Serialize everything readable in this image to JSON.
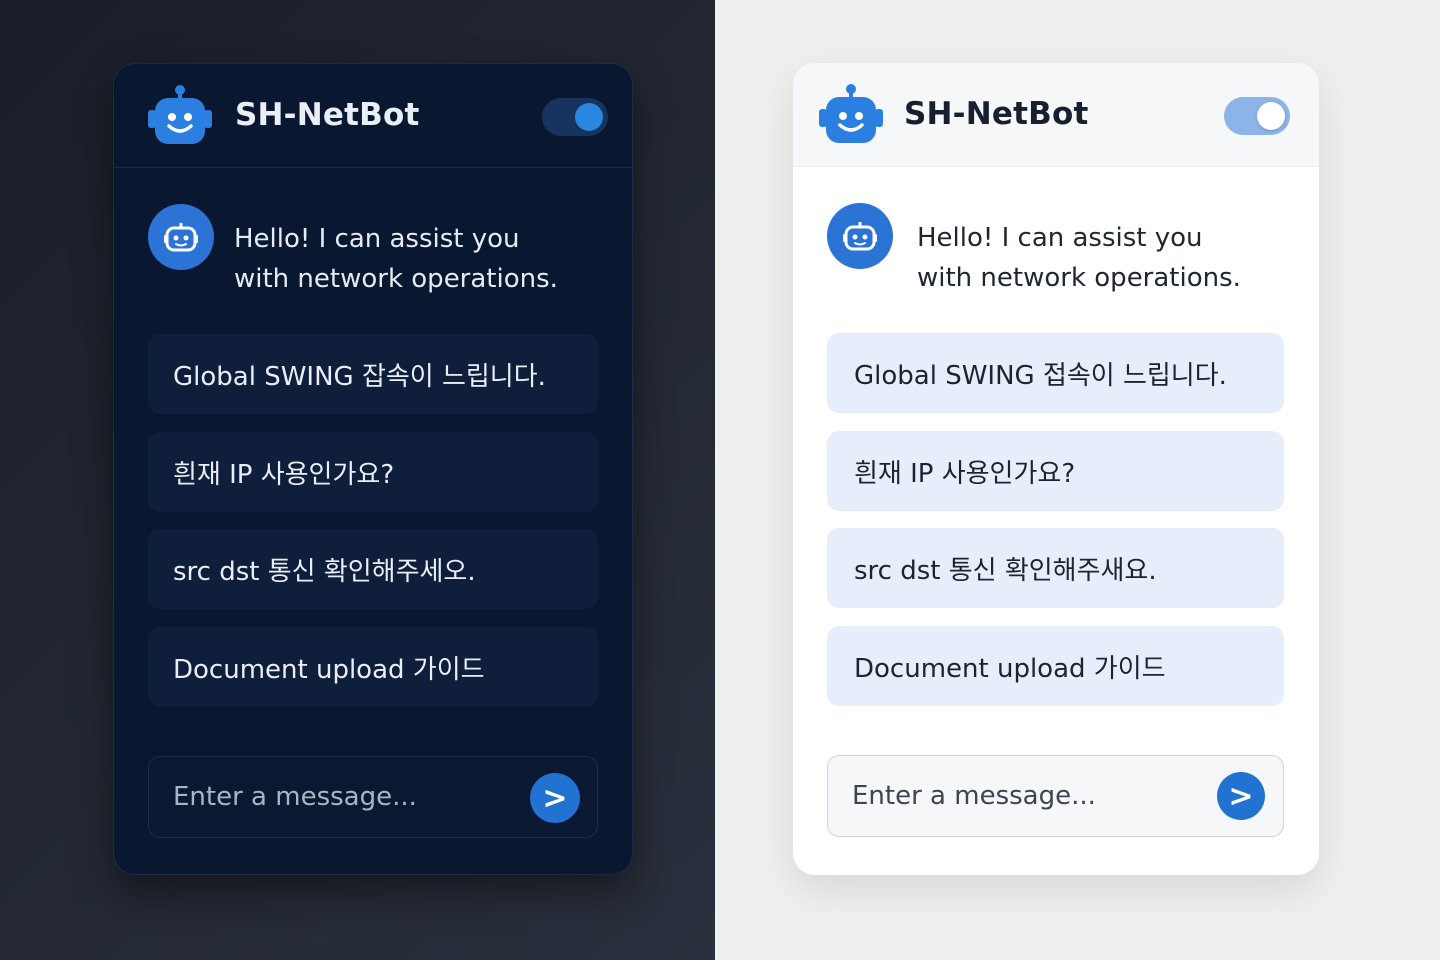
{
  "panels": [
    {
      "theme": "dark",
      "header": {
        "title": "SH-NetBot",
        "toggle_on": true
      },
      "greeting": {
        "line1": "Hello! I can assist you",
        "line2": "with network operations."
      },
      "suggestions": [
        "Global SWING 잡속이 느립니다.",
        "흰재 IP 사용인가요?",
        "src dst 통신 확인해주세오.",
        "Document upload 가이드"
      ],
      "input": {
        "placeholder": "Enter a message..."
      },
      "send_icon": ">"
    },
    {
      "theme": "light",
      "header": {
        "title": "SH-NetBot",
        "toggle_on": true
      },
      "greeting": {
        "line1": "Hello! I can assist you",
        "line2": "with network operations."
      },
      "suggestions": [
        "Global SWING 접속이 느립니다.",
        "흰재 IP 사용인가요?",
        "src dst 통신 확인해주새요.",
        "Document upload 가이드"
      ],
      "input": {
        "placeholder": "Enter a message..."
      },
      "send_icon": ">"
    }
  ],
  "colors": {
    "accent": "#2b73d4",
    "dark_panel_bg": "#0a1730",
    "light_chip_bg": "#e6eefb"
  },
  "icons": {
    "logo": "robot-icon",
    "avatar": "bot-face-icon",
    "send": "send-arrow-icon"
  }
}
